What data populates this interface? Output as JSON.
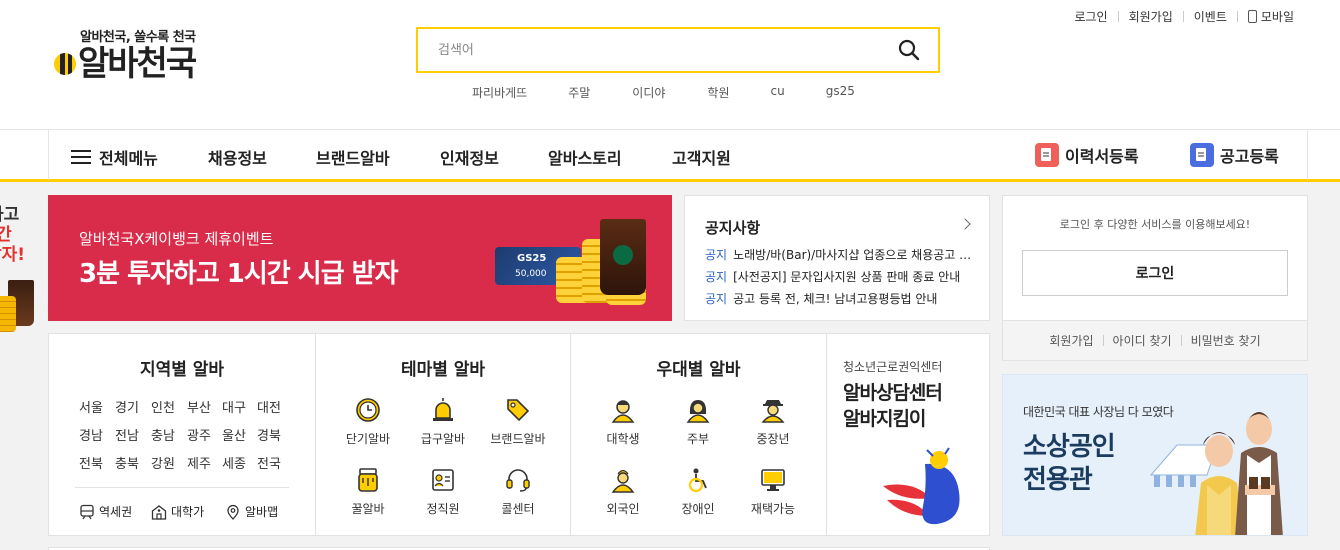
{
  "header": {
    "top_links": {
      "login": "로그인",
      "signup": "회원가입",
      "event": "이벤트",
      "mobile": "모바일"
    },
    "logo": {
      "slogan": "알바천국, 쓸수록 천국",
      "name": "알바천국"
    },
    "search": {
      "placeholder": "검색어"
    },
    "keywords": [
      "파리바게뜨",
      "주말",
      "이디야",
      "학원",
      "cu",
      "gs25"
    ]
  },
  "gnb": {
    "all_menu": "전체메뉴",
    "items": [
      "채용정보",
      "브랜드알바",
      "인재정보",
      "알바스토리",
      "고객지원"
    ],
    "resume_register": "이력서등록",
    "job_register": "공고등록",
    "resume_color": "#f0605a",
    "job_color": "#4a6ee0"
  },
  "left_peek": {
    "line1": "하고",
    "line2": "간",
    "line3": "받자!"
  },
  "banner": {
    "sub": "알바천국X케이뱅크 제휴이벤트",
    "main": "3분 투자하고 1시간 시급 받자",
    "card_brand": "GS25",
    "card_amount": "50,000",
    "bg_color": "#d82c4a"
  },
  "notice": {
    "title": "공지사항",
    "items": [
      {
        "tag": "공지",
        "text": "노래방/바(Bar)/마사지샵 업종으로 채용공고 등록 시 유의사항 안내"
      },
      {
        "tag": "공지",
        "text": "[사전공지] 문자입사지원 상품 판매 종료 안내"
      },
      {
        "tag": "공지",
        "text": "공고 등록 전, 체크! 남녀고용평등법 안내"
      }
    ]
  },
  "login": {
    "message": "로그인 후 다양한 서비스를 이용해보세요!",
    "button": "로그인",
    "links": [
      "회원가입",
      "아이디 찾기",
      "비밀번호 찾기"
    ]
  },
  "side_banner": {
    "line1": "대한민국 대표 사장님 다 모였다",
    "line2": "소상공인 전용관"
  },
  "categories": {
    "region": {
      "title": "지역별 알바",
      "rows": [
        [
          "서울",
          "경기",
          "인천",
          "부산",
          "대구",
          "대전"
        ],
        [
          "경남",
          "전남",
          "충남",
          "광주",
          "울산",
          "경북"
        ],
        [
          "전북",
          "충북",
          "강원",
          "제주",
          "세종",
          "전국"
        ]
      ],
      "utils": [
        {
          "label": "역세권",
          "icon": "subway-icon"
        },
        {
          "label": "대학가",
          "icon": "school-icon"
        },
        {
          "label": "알바맵",
          "icon": "map-pin-icon"
        }
      ]
    },
    "theme": {
      "title": "테마별 알바",
      "items": [
        {
          "label": "단기알바",
          "icon": "clock-icon"
        },
        {
          "label": "급구알바",
          "icon": "siren-icon"
        },
        {
          "label": "브랜드알바",
          "icon": "tag-icon"
        },
        {
          "label": "꿀알바",
          "icon": "honey-jar-icon"
        },
        {
          "label": "정직원",
          "icon": "id-card-icon"
        },
        {
          "label": "콜센터",
          "icon": "headset-icon"
        }
      ]
    },
    "preferential": {
      "title": "우대별 알바",
      "items": [
        {
          "label": "대학생",
          "icon": "student-icon"
        },
        {
          "label": "주부",
          "icon": "housewife-icon"
        },
        {
          "label": "중장년",
          "icon": "senior-icon"
        },
        {
          "label": "외국인",
          "icon": "foreigner-icon"
        },
        {
          "label": "장애인",
          "icon": "wheelchair-icon"
        },
        {
          "label": "재택가능",
          "icon": "monitor-icon"
        }
      ]
    },
    "center": {
      "org": "청소년근로권익센터",
      "line1": "알바상담센터",
      "line2": "알바지킴이"
    }
  },
  "colors": {
    "brand_yellow": "#ffcd00",
    "notice_blue": "#2d63c8",
    "icon_gold": "#c89a00"
  }
}
